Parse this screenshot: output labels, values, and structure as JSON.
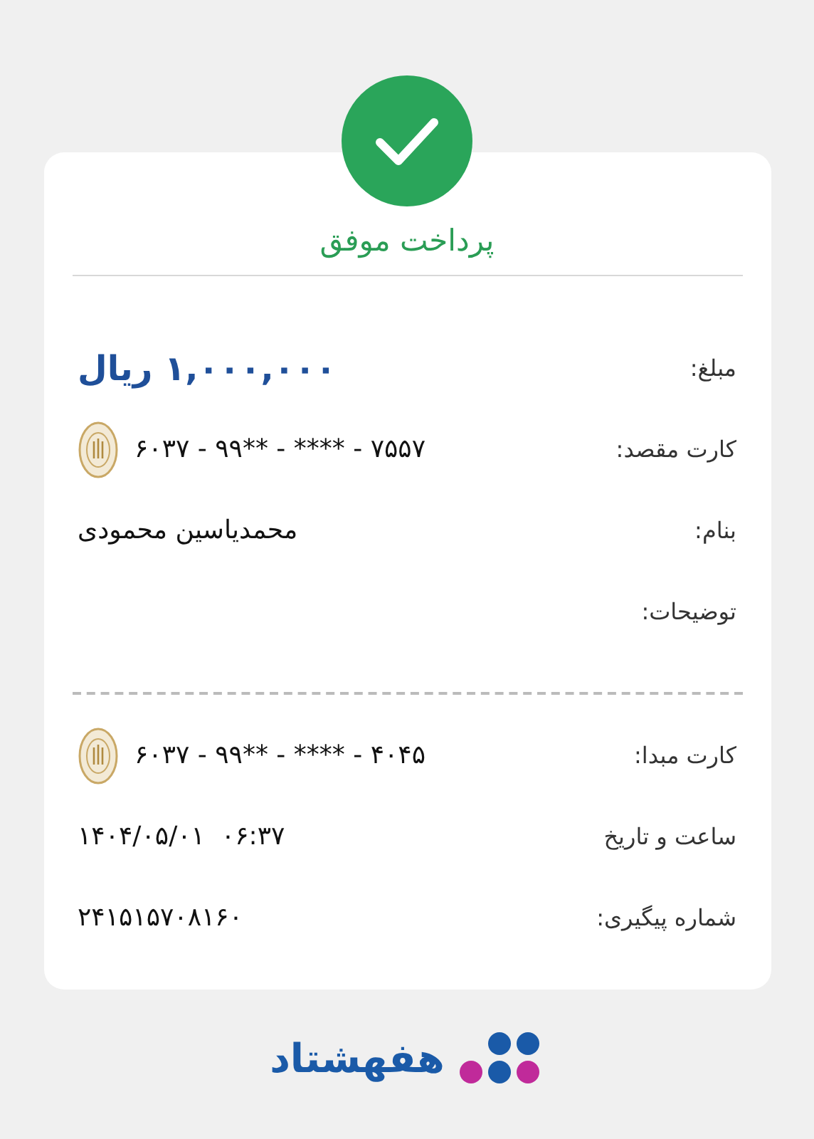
{
  "receipt": {
    "status": "پرداخت موفق",
    "details": [
      {
        "kind": "amount",
        "label": "مبلغ:",
        "value": "۱,۰۰۰,۰۰۰ ریال"
      },
      {
        "kind": "card",
        "label": "کارت مقصد:",
        "value": "۶۰۳۷ - ۹۹** - **** - ۷۵۵۷"
      },
      {
        "kind": "text",
        "label": "بنام:",
        "value": "محمدیاسین محمودی"
      },
      {
        "kind": "text",
        "label": "توضیحات:"
      }
    ],
    "source": [
      {
        "kind": "card",
        "label": "کارت مبدا:",
        "value": "۶۰۳۷ - ۹۹** - **** - ۴۰۴۵"
      },
      {
        "kind": "datetime",
        "label": "ساعت و تاریخ",
        "value": "۱۴۰۴/۰۵/۰۱  ۰۶:۳۷"
      },
      {
        "kind": "text",
        "label": "شماره پیگیری:",
        "value": "۲۴۱۵۱۵۷۰۸۱۶۰"
      }
    ]
  },
  "brand": {
    "name": "هفهشتاد"
  }
}
